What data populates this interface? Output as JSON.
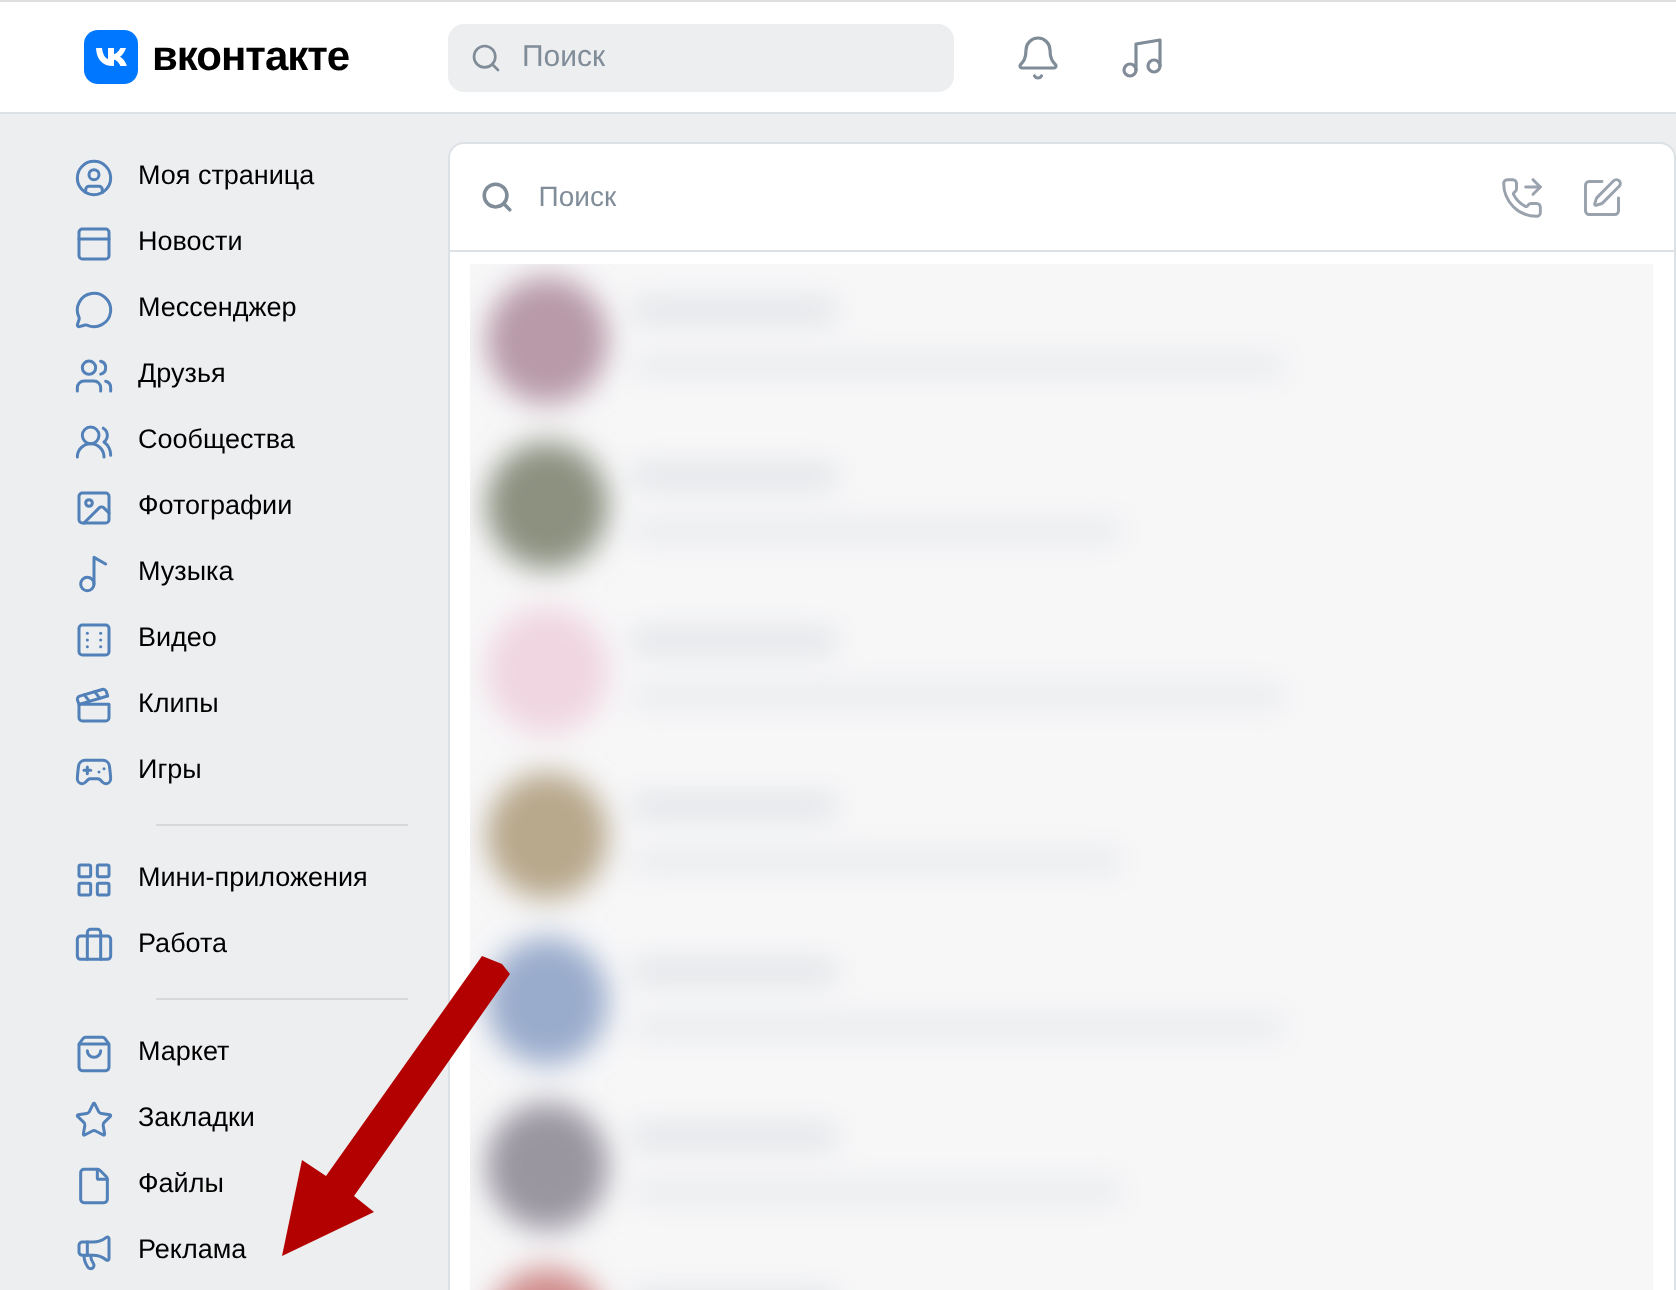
{
  "header": {
    "logo_text": "вконтакте",
    "search": {
      "placeholder": "Поиск"
    }
  },
  "sidebar": {
    "groups": [
      {
        "items": [
          {
            "label": "Моя страница"
          },
          {
            "label": "Новости"
          },
          {
            "label": "Мессенджер"
          },
          {
            "label": "Друзья"
          },
          {
            "label": "Сообщества"
          },
          {
            "label": "Фотографии"
          },
          {
            "label": "Музыка"
          },
          {
            "label": "Видео"
          },
          {
            "label": "Клипы"
          },
          {
            "label": "Игры"
          }
        ]
      },
      {
        "items": [
          {
            "label": "Мини-приложения"
          },
          {
            "label": "Работа"
          }
        ]
      },
      {
        "items": [
          {
            "label": "Маркет"
          },
          {
            "label": "Закладки"
          },
          {
            "label": "Файлы"
          },
          {
            "label": "Реклама"
          }
        ]
      }
    ]
  },
  "messenger": {
    "search": {
      "placeholder": "Поиск"
    }
  }
}
